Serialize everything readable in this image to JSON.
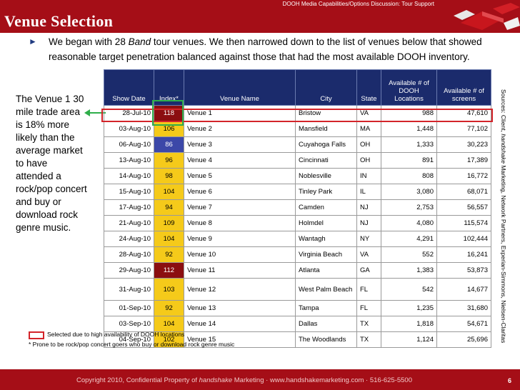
{
  "header": {
    "top_label": "DOOH Media Capabilities/Options Discussion: Tour Support",
    "title": "Venue Selection"
  },
  "intro": {
    "arrow_icon": "right-triangle-icon",
    "before": "We began with 28 ",
    "band": "Band",
    "after": " tour venues.  We then narrowed down to the list of venues below that showed reasonable target penetration balanced against those that had the most available DOOH inventory."
  },
  "callout": "The Venue 1 30 mile trade area is 18% more likely than the average market to have attended a rock/pop concert and buy or download rock genre music.",
  "table": {
    "headers": [
      "Show Date",
      "Index*",
      "Venue Name",
      "City",
      "State",
      "Available # of DOOH Locations",
      "Available # of screens"
    ],
    "rows": [
      {
        "date": "28-Jul-10",
        "index": "118",
        "venue": "Venue 1",
        "city": "Bristow",
        "state": "VA",
        "locations": "988",
        "screens": "47,610",
        "style": "dark"
      },
      {
        "date": "03-Aug-10",
        "index": "106",
        "venue": "Venue 2",
        "city": "Mansfield",
        "state": "MA",
        "locations": "1,448",
        "screens": "77,102",
        "style": ""
      },
      {
        "date": "06-Aug-10",
        "index": "86",
        "venue": "Venue 3",
        "city": "Cuyahoga Falls",
        "state": "OH",
        "locations": "1,333",
        "screens": "30,223",
        "style": "blue"
      },
      {
        "date": "13-Aug-10",
        "index": "96",
        "venue": "Venue 4",
        "city": "Cincinnati",
        "state": "OH",
        "locations": "891",
        "screens": "17,389",
        "style": ""
      },
      {
        "date": "14-Aug-10",
        "index": "98",
        "venue": "Venue 5",
        "city": "Noblesville",
        "state": "IN",
        "locations": "808",
        "screens": "16,772",
        "style": ""
      },
      {
        "date": "15-Aug-10",
        "index": "104",
        "venue": "Venue 6",
        "city": "Tinley Park",
        "state": "IL",
        "locations": "3,080",
        "screens": "68,071",
        "style": ""
      },
      {
        "date": "17-Aug-10",
        "index": "94",
        "venue": "Venue 7",
        "city": "Camden",
        "state": "NJ",
        "locations": "2,753",
        "screens": "56,557",
        "style": ""
      },
      {
        "date": "21-Aug-10",
        "index": "109",
        "venue": "Venue 8",
        "city": "Holmdel",
        "state": "NJ",
        "locations": "4,080",
        "screens": "115,574",
        "style": ""
      },
      {
        "date": "24-Aug-10",
        "index": "104",
        "venue": "Venue 9",
        "city": "Wantagh",
        "state": "NY",
        "locations": "4,291",
        "screens": "102,444",
        "style": ""
      },
      {
        "date": "28-Aug-10",
        "index": "92",
        "venue": "Venue 10",
        "city": "Virginia Beach",
        "state": "VA",
        "locations": "552",
        "screens": "16,241",
        "style": ""
      },
      {
        "date": "29-Aug-10",
        "index": "112",
        "venue": "Venue 11",
        "city": "Atlanta",
        "state": "GA",
        "locations": "1,383",
        "screens": "53,873",
        "style": "dark"
      },
      {
        "date": "31-Aug-10",
        "index": "103",
        "venue": "Venue 12",
        "city": "West Palm Beach",
        "state": "FL",
        "locations": "542",
        "screens": "14,677",
        "style": "",
        "tall": true
      },
      {
        "date": "01-Sep-10",
        "index": "92",
        "venue": "Venue 13",
        "city": "Tampa",
        "state": "FL",
        "locations": "1,235",
        "screens": "31,680",
        "style": ""
      },
      {
        "date": "03-Sep-10",
        "index": "104",
        "venue": "Venue 14",
        "city": "Dallas",
        "state": "TX",
        "locations": "1,818",
        "screens": "54,671",
        "style": ""
      },
      {
        "date": "04-Sep-10",
        "index": "102",
        "venue": "Venue 15",
        "city": "The Woodlands",
        "state": "TX",
        "locations": "1,124",
        "screens": "25,696",
        "style": ""
      }
    ]
  },
  "sources": {
    "before": "Sources:   Client, ",
    "italic": "handshake",
    "after": " Marketing, Network Partners, Experian-Simmons, Nielsen-Claritas"
  },
  "legend": {
    "selected": "Selected due to high availability of DOOH locations",
    "footnote": "* Prone to be rock/pop concert goers who buy or download rock genre music"
  },
  "footer": {
    "before": "Copyright 2010, Confidential Property of ",
    "italic": "handshake",
    "after": " Marketing · www.handshakemarketing.com · 516-625-5500",
    "page": "6"
  },
  "colors": {
    "brand_red": "#a50e17",
    "header_navy": "#1b2b6c",
    "index_yellow": "#f5ca1a",
    "index_dark_red": "#8b0e10",
    "index_blue": "#3c48a8",
    "selection_red": "#d3242a",
    "highlight_green": "#2fae4a"
  }
}
